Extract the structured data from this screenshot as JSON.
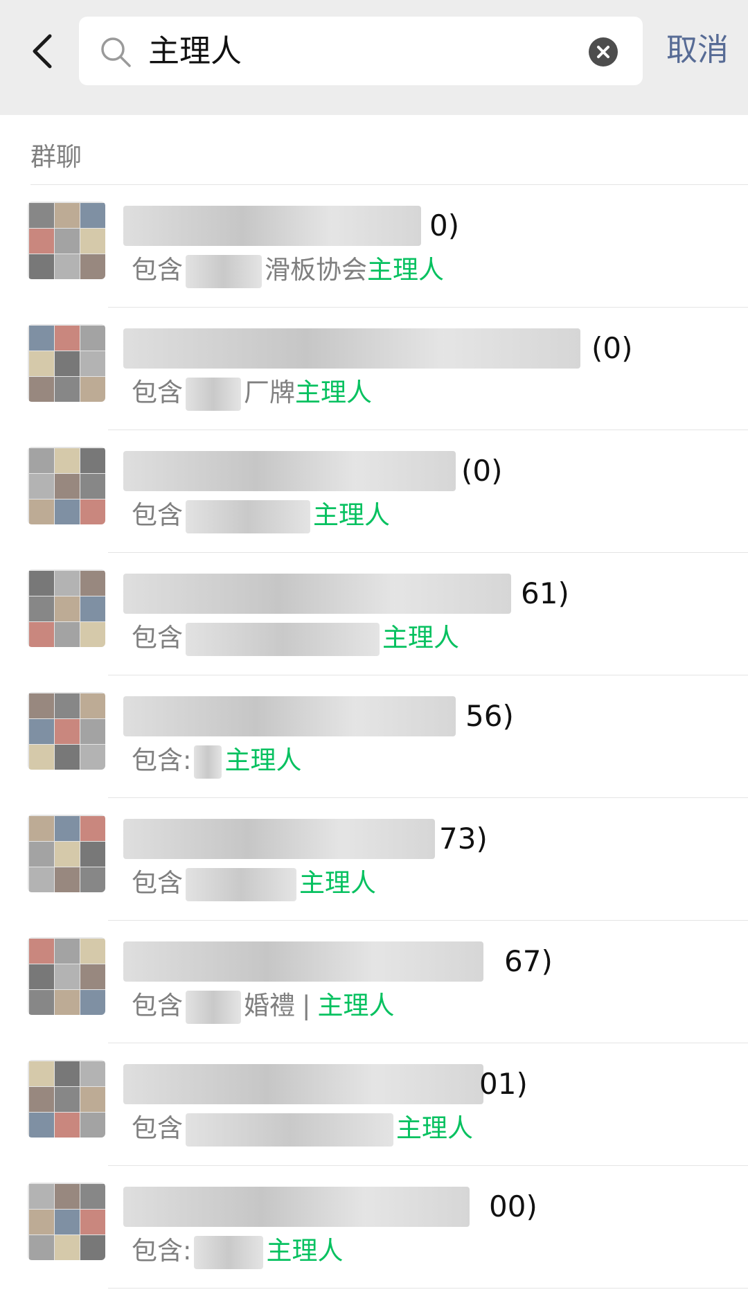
{
  "header": {
    "search_value": "主理人",
    "cancel_label": "取消"
  },
  "section": {
    "label": "群聊"
  },
  "results": [
    {
      "count": "0)",
      "prefix": "包含",
      "middle": "滑板协会",
      "highlight": "主理人",
      "suffix": ""
    },
    {
      "count": "(0)",
      "prefix": "包含",
      "middle": "厂牌",
      "highlight": "主理人",
      "suffix": ""
    },
    {
      "count": "(0)",
      "prefix": "包含",
      "middle": "",
      "highlight": "主理人",
      "suffix": ""
    },
    {
      "count": "61)",
      "prefix": "包含",
      "middle": "",
      "highlight": "主理人",
      "suffix": ""
    },
    {
      "count": "56)",
      "prefix": "包含:",
      "middle": "",
      "highlight": "主理人",
      "suffix": ""
    },
    {
      "count": "73)",
      "prefix": "包含",
      "middle": "",
      "highlight": "主理人",
      "suffix": ""
    },
    {
      "count": "67)",
      "prefix": "包含",
      "middle": "婚禮",
      "highlight": "主理人",
      "suffix": "|"
    },
    {
      "count": "01)",
      "prefix": "包含",
      "middle": "",
      "highlight": "主理人",
      "suffix": ""
    },
    {
      "count": "00)",
      "prefix": "包含:",
      "middle": "",
      "highlight": "主理人",
      "suffix": ""
    }
  ],
  "colors": {
    "highlight": "#07c160",
    "cancel": "#576b95",
    "header_bg": "#ededed"
  },
  "icons": {
    "back": "chevron-left-icon",
    "search": "search-icon",
    "clear": "clear-icon"
  }
}
